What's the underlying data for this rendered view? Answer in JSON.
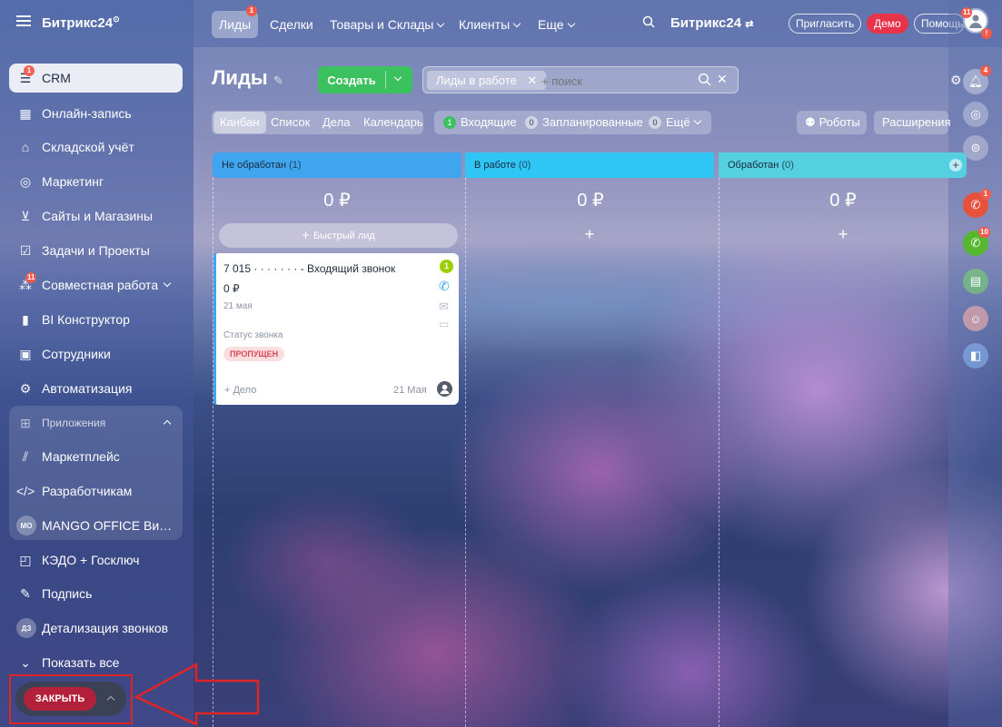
{
  "app": {
    "logo": "Битрикс24",
    "logo_mark": "⊙"
  },
  "sidebar": {
    "items": [
      {
        "label": "CRM",
        "icon": "crm-filter-icon",
        "badge": "1",
        "active": true
      },
      {
        "label": "Онлайн-запись",
        "icon": "calendar-icon"
      },
      {
        "label": "Складской учёт",
        "icon": "warehouse-icon"
      },
      {
        "label": "Маркетинг",
        "icon": "target-icon"
      },
      {
        "label": "Сайты и Магазины",
        "icon": "cart-icon"
      },
      {
        "label": "Задачи и Проекты",
        "icon": "checkbox-icon"
      },
      {
        "label": "Совместная работа",
        "icon": "collab-icon",
        "badge": "11"
      },
      {
        "label": "BI Конструктор",
        "icon": "bars-icon"
      },
      {
        "label": "Сотрудники",
        "icon": "people-icon"
      },
      {
        "label": "Автоматизация",
        "icon": "robot-icon"
      }
    ],
    "apps_header": "Приложения",
    "apps": [
      {
        "label": "Маркетплейс",
        "icon": "marketplace-icon"
      },
      {
        "label": "Разработчикам",
        "icon": "code-icon"
      },
      {
        "label": "MANGO OFFICE Вирт...",
        "icon_text": "MO"
      }
    ],
    "more_items": [
      {
        "label": "КЭДО + Госключ",
        "icon": "kedo-icon"
      },
      {
        "label": "Подпись",
        "icon": "pen-icon"
      },
      {
        "label": "Детализация звонков",
        "icon_text": "ДЗ"
      }
    ],
    "show_all": "Показать все"
  },
  "topbar": {
    "tabs": [
      {
        "label": "Лиды",
        "badge": "1",
        "active": true
      },
      {
        "label": "Сделки"
      },
      {
        "label": "Товары и Склады",
        "dropdown": true
      },
      {
        "label": "Клиенты",
        "dropdown": true
      },
      {
        "label": "Еще",
        "dropdown": true
      }
    ],
    "brand": "Битрикс24",
    "invite": "Пригласить",
    "demo": "Демо",
    "help": "Помощь",
    "avatar_badge": "11",
    "demo_color": "#e8344a"
  },
  "page": {
    "title": "Лиды",
    "create": "Создать",
    "filter_chip": "Лиды в работе",
    "search_placeholder": "+ поиск",
    "views": [
      "Канбан",
      "Список",
      "Дела",
      "Календарь"
    ],
    "counters": [
      {
        "count": "1",
        "label": "Входящие"
      },
      {
        "count": "0",
        "label": "Запланированные"
      },
      {
        "count": "0",
        "label": "Ещё"
      }
    ],
    "robots": "Роботы",
    "extensions": "Расширения"
  },
  "kanban": {
    "columns": [
      {
        "name": "Не обработан",
        "count": "(1)",
        "sum": "0 ₽",
        "color": "#3fa5ef"
      },
      {
        "name": "В работе",
        "count": "(0)",
        "sum": "0 ₽",
        "color": "#2fc6f6"
      },
      {
        "name": "Обработан",
        "count": "(0)",
        "sum": "0 ₽",
        "color": "#55d0e0"
      }
    ],
    "quick_lead": "Быстрый лид",
    "card": {
      "title": "7 015 · · · · · · · - Входящий звонок",
      "badge": "1",
      "sum": "0 ₽",
      "date": "21 мая",
      "status_label": "Статус звонка",
      "status": "ПРОПУЩЕН",
      "add_deal": "+ Дело",
      "footer_date": "21 Мая"
    }
  },
  "right_panel": {
    "notif_badge": "4",
    "call_badge": "1",
    "call2_badge": "10"
  },
  "bottom": {
    "close": "ЗАКРЫТЬ"
  }
}
